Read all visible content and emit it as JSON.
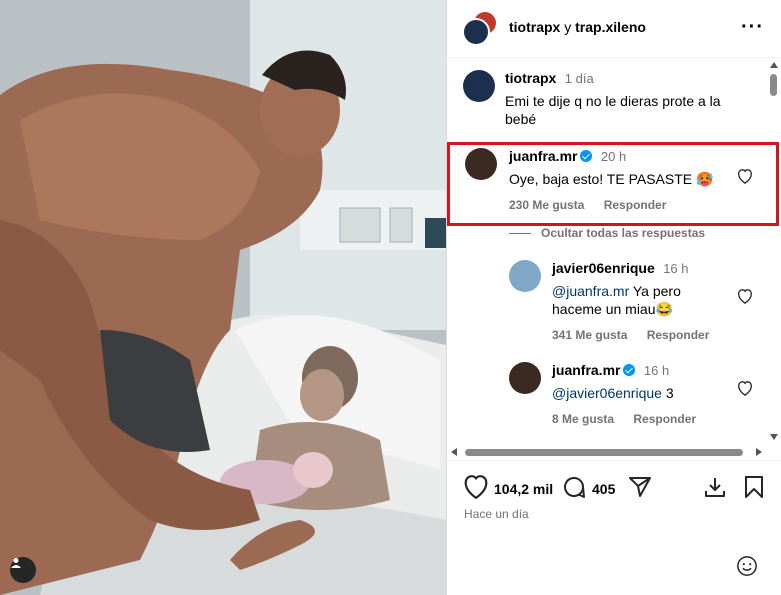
{
  "header": {
    "user1": "tiotrapx",
    "connector": "y",
    "user2": "trap.xileno",
    "more_icon": "more-horizontal-icon"
  },
  "comments": [
    {
      "username": "tiotrapx",
      "time": "1 día",
      "text": "Emi te dije q no le dieras prote a la bebé"
    },
    {
      "username": "juanfra.mr",
      "verified": true,
      "time": "20 h",
      "text": "Oye, baja esto! TE PASASTE 🥵",
      "likes": "230 Me gusta",
      "reply": "Responder",
      "highlight_color": "#d4141e"
    }
  ],
  "hide_replies": "Ocultar todas las respuestas",
  "replies": [
    {
      "username": "javier06enrique",
      "time": "16 h",
      "mention": "@juanfra.mr",
      "text": "Ya pero haceme un miau😂",
      "likes": "341 Me gusta",
      "reply": "Responder"
    },
    {
      "username": "juanfra.mr",
      "verified": true,
      "time": "16 h",
      "mention": "@javier06enrique",
      "text": "3",
      "likes": "8 Me gusta",
      "reply": "Responder"
    }
  ],
  "actions": {
    "likes_count": "104,2 mil",
    "comments_count": "405",
    "time_ago": "Hace un día"
  },
  "colors": {
    "verified": "#0095f6",
    "secondary_text": "#737373",
    "highlight": "#d4141e"
  }
}
